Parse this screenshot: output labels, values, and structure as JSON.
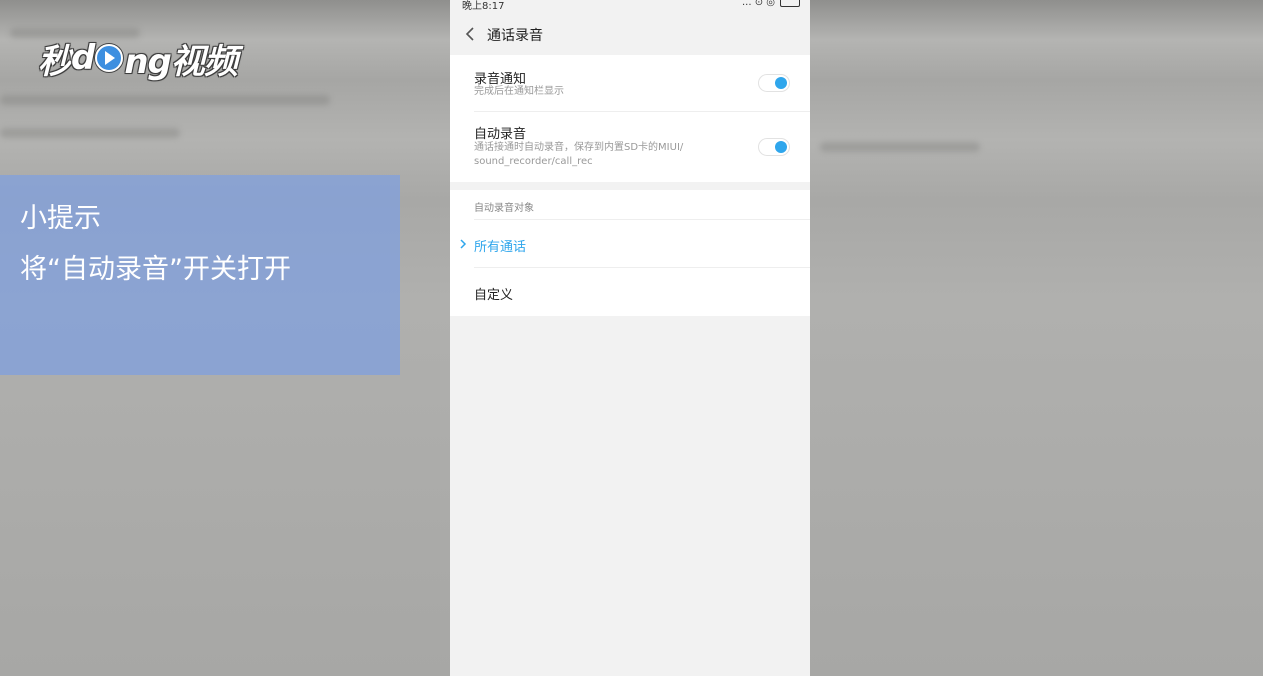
{
  "watermark": {
    "logo_text_a": "秒",
    "logo_text_b": "d",
    "logo_text_c": "ng视频"
  },
  "tip": {
    "title": "小提示",
    "text": "将“自动录音”开关打开"
  },
  "status_bar": {
    "time": "晚上8:17",
    "icons": "... ⊙ ◎"
  },
  "header": {
    "title": "通话录音",
    "back_icon": "chevron-left-icon"
  },
  "settings": {
    "record_notify": {
      "title": "录音通知",
      "subtitle": "完成后在通知栏显示",
      "enabled": true
    },
    "auto_record": {
      "title": "自动录音",
      "subtitle": "通话接通时自动录音，保存到内置SD卡的MIUI/ sound_recorder/call_rec",
      "enabled": true
    }
  },
  "auto_record_target": {
    "section_label": "自动录音对象",
    "options": [
      {
        "label": "所有通话",
        "selected": true
      },
      {
        "label": "自定义",
        "selected": false
      }
    ]
  },
  "colors": {
    "accent": "#2fa6ec",
    "tip_bg": "#82a0dc"
  }
}
